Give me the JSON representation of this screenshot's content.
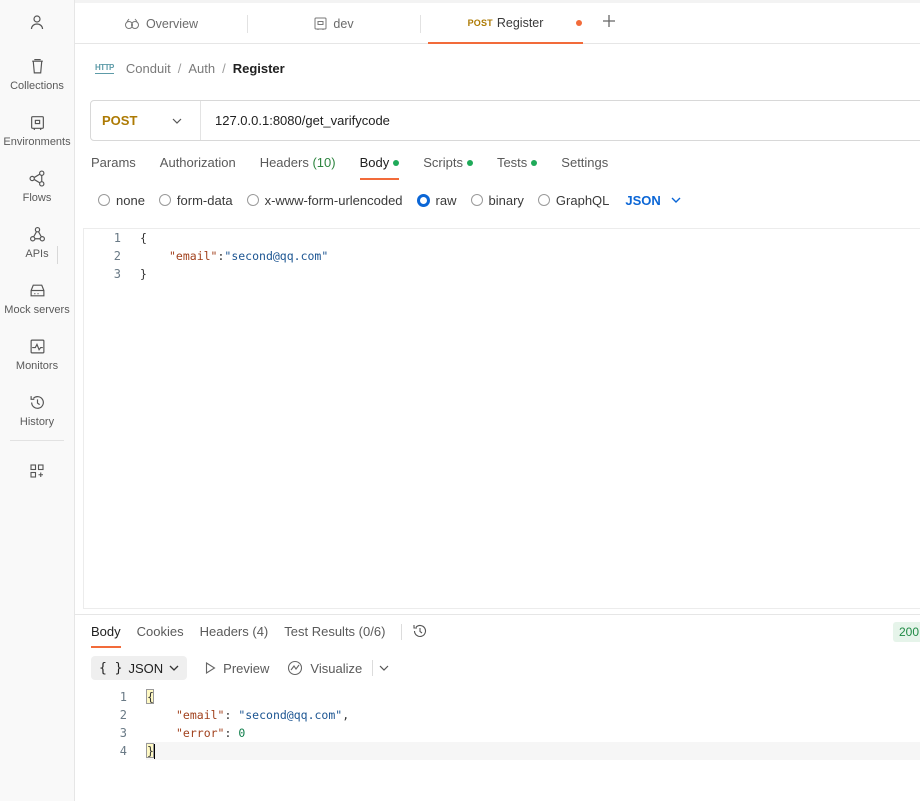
{
  "sidebar": {
    "items": [
      {
        "label": "Collections",
        "icon": "trash-bin-icon"
      },
      {
        "label": "Environments",
        "icon": "environment-icon"
      },
      {
        "label": "Flows",
        "icon": "flows-icon"
      },
      {
        "label": "APIs",
        "icon": "apis-icon"
      },
      {
        "label": "Mock servers",
        "icon": "mock-server-icon"
      },
      {
        "label": "Monitors",
        "icon": "monitor-icon"
      },
      {
        "label": "History",
        "icon": "history-icon"
      }
    ]
  },
  "tabs": {
    "overview": "Overview",
    "dev": "dev",
    "register_method": "POST",
    "register": "Register"
  },
  "breadcrumb": {
    "icon": "HTTP",
    "parts": [
      "Conduit",
      "Auth"
    ],
    "current": "Register"
  },
  "request": {
    "method": "POST",
    "url": "127.0.0.1:8080/get_varifycode",
    "tabs": {
      "params": "Params",
      "authorization": "Authorization",
      "headers": "Headers",
      "headers_count": "(10)",
      "body": "Body",
      "scripts": "Scripts",
      "tests": "Tests",
      "settings": "Settings"
    },
    "body_types": [
      "none",
      "form-data",
      "x-www-form-urlencoded",
      "raw",
      "binary",
      "GraphQL"
    ],
    "body_type_selected": "raw",
    "body_language": "JSON",
    "body_lines": [
      {
        "n": "1",
        "text": "{"
      },
      {
        "n": "2",
        "key": "\"email\"",
        "sep": ":",
        "value": "\"second@qq.com\""
      },
      {
        "n": "3",
        "text": "}"
      }
    ]
  },
  "response": {
    "tabs": {
      "body": "Body",
      "cookies": "Cookies",
      "headers": "Headers (4)",
      "test_results": "Test Results (0/6)"
    },
    "status": "200",
    "format": "JSON",
    "format_braces": "{ }",
    "preview": "Preview",
    "visualize": "Visualize",
    "lines": [
      {
        "n": "1",
        "text": "{"
      },
      {
        "n": "2",
        "key": "\"email\"",
        "sep": ": ",
        "value": "\"second@qq.com\"",
        "tail": ","
      },
      {
        "n": "3",
        "key": "\"error\"",
        "sep": ": ",
        "value": "0"
      },
      {
        "n": "4",
        "text": "}"
      }
    ]
  },
  "colors": {
    "accent": "#f26b3a",
    "post": "#ad7a03",
    "link": "#0b66d6",
    "success": "#1faa59"
  }
}
